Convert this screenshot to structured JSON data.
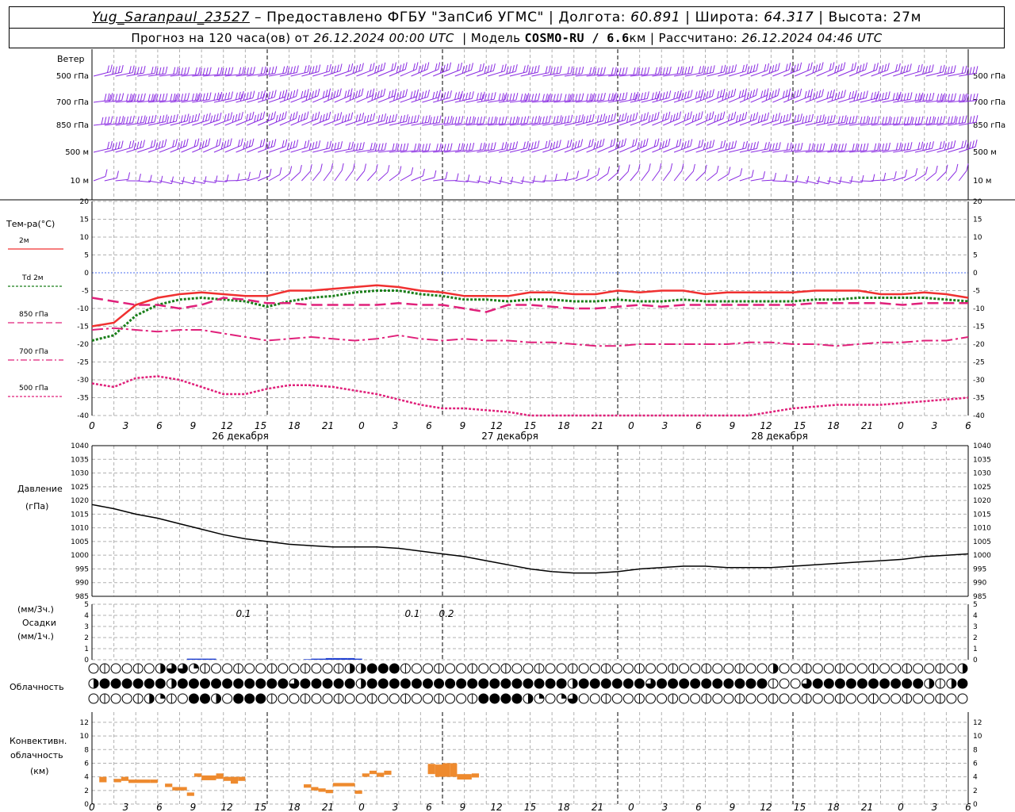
{
  "header": {
    "station": "Yug_Saranpaul_23527",
    "provider": "– Предоставлено ФГБУ \"ЗапСиб УГМС\"",
    "lon_label": "Долгота:",
    "lon": "60.891",
    "lat_label": "Широта:",
    "lat": "64.317",
    "alt_label": "Высота:",
    "alt": "27м",
    "forecast_prefix": "Прогноз на 120 часа(ов) от",
    "forecast_start": "26.12.2024 00:00 UTC",
    "model_label": "Модель",
    "model": "COSMO-RU / 6.6",
    "model_unit": "км",
    "calc_label": "Рассчитано:",
    "calc_time": "26.12.2024 04:46 UTC"
  },
  "wind_panel": {
    "title": "Ветер",
    "levels": [
      "500 гПа",
      "700 гПа",
      "850 гПа",
      "500 м",
      "10 м"
    ],
    "color": "#8a2be2"
  },
  "temp_panel": {
    "title": "Тем-ра(°C)",
    "legend": [
      {
        "label": "2м",
        "color": "#f03030",
        "style": "solid"
      },
      {
        "label": "Td 2м",
        "color": "#1a7f1a",
        "style": "dotted"
      },
      {
        "label": "850 гПа",
        "color": "#e0207a",
        "style": "dashed"
      },
      {
        "label": "700 гПа",
        "color": "#e0207a",
        "style": "dashdot"
      },
      {
        "label": "500 гПа",
        "color": "#e0207a",
        "style": "dotted"
      }
    ],
    "yticks": [
      "20",
      "15",
      "10",
      "5",
      "0",
      "-5",
      "-10",
      "-15",
      "-20",
      "-25",
      "-30",
      "-35",
      "-40"
    ]
  },
  "xaxis": {
    "hour_labels": [
      "0",
      "3",
      "6",
      "9",
      "12",
      "15",
      "18",
      "21",
      "0",
      "3",
      "6",
      "9",
      "12",
      "15",
      "18",
      "21",
      "0",
      "3",
      "6",
      "9",
      "12",
      "15",
      "18",
      "21",
      "0",
      "3",
      "6"
    ],
    "day_labels": [
      "26 декабря",
      "27 декабря",
      "28 декабря"
    ]
  },
  "pressure_panel": {
    "title": "Давление",
    "unit": "(гПа)",
    "yticks": [
      "1040",
      "1035",
      "1030",
      "1025",
      "1020",
      "1015",
      "1010",
      "1005",
      "1000",
      "995",
      "990",
      "985"
    ]
  },
  "precip_panel": {
    "unit_top": "(мм/3ч.)",
    "title": "Осадки",
    "unit_bottom": "(мм/1ч.)",
    "yticks": [
      "5",
      "4",
      "3",
      "2",
      "1",
      "0"
    ],
    "annotations": [
      "0.1",
      "0.1",
      "0.2"
    ]
  },
  "cloud_panel": {
    "title": "Облачность"
  },
  "conv_panel": {
    "title_line1": "Конвективн.",
    "title_line2": "облачность",
    "unit": "(км)",
    "yticks": [
      "12",
      "10",
      "8",
      "6",
      "4",
      "2",
      "0"
    ]
  },
  "chart_data": [
    {
      "type": "line",
      "title": "Тем-ра(°C)",
      "x_hours": [
        0,
        3,
        6,
        9,
        12,
        15,
        18,
        21,
        24,
        27,
        30,
        33,
        36,
        39,
        42,
        45,
        48,
        51,
        54,
        57,
        60,
        63,
        66,
        69,
        72,
        75,
        78,
        81,
        84,
        87,
        90,
        93,
        96,
        99,
        102,
        105,
        108,
        111,
        114,
        117,
        120
      ],
      "ylim": [
        -40,
        20
      ],
      "series": [
        {
          "name": "2м",
          "values": [
            -15,
            -14,
            -9,
            -7,
            -6,
            -5.5,
            -6,
            -6.5,
            -6.5,
            -5,
            -5,
            -4.5,
            -4,
            -3.5,
            -4,
            -5,
            -5.5,
            -6.5,
            -6.5,
            -6.5,
            -5.5,
            -5.5,
            -6,
            -6,
            -5,
            -5.5,
            -5,
            -5,
            -6,
            -5.5,
            -5.5,
            -5.5,
            -5.5,
            -5,
            -5,
            -5,
            -6,
            -6,
            -5.5,
            -6,
            -7
          ]
        },
        {
          "name": "Td 2м",
          "values": [
            -19,
            -17.5,
            -12,
            -9,
            -7.5,
            -7,
            -7.5,
            -8,
            -9.5,
            -8,
            -7,
            -6.5,
            -5.5,
            -5,
            -5,
            -6,
            -6.5,
            -7.5,
            -7.5,
            -8,
            -7.5,
            -7.5,
            -8,
            -8,
            -7.5,
            -8,
            -8,
            -7.5,
            -8,
            -8,
            -8,
            -8,
            -8,
            -7.5,
            -7.5,
            -7,
            -7,
            -7,
            -7,
            -7.5,
            -8
          ]
        },
        {
          "name": "850 гПа",
          "values": [
            -7,
            -8,
            -9,
            -9,
            -10,
            -9,
            -7,
            -7.5,
            -8.5,
            -8.5,
            -9,
            -9,
            -9,
            -9,
            -8.5,
            -9,
            -9,
            -10,
            -11,
            -9,
            -9,
            -9.5,
            -10,
            -10,
            -9.5,
            -9,
            -9.5,
            -9,
            -9,
            -9,
            -9,
            -9,
            -9,
            -8.5,
            -8.5,
            -8.5,
            -8.5,
            -9,
            -8.5,
            -8.5,
            -8.5
          ]
        },
        {
          "name": "700 гПа",
          "values": [
            -16,
            -15.5,
            -16,
            -16.5,
            -16,
            -16,
            -17,
            -18,
            -19,
            -18.5,
            -18,
            -18.5,
            -19,
            -18.5,
            -17.5,
            -18.5,
            -19,
            -18.5,
            -19,
            -19,
            -19.5,
            -19.5,
            -20,
            -20.5,
            -20.5,
            -20,
            -20,
            -20,
            -20,
            -20,
            -19.5,
            -19.5,
            -20,
            -20,
            -20.5,
            -20,
            -19.5,
            -19.5,
            -19,
            -19,
            -18
          ]
        },
        {
          "name": "500 гПа",
          "values": [
            -31,
            -32,
            -29.5,
            -29,
            -30,
            -32,
            -34,
            -34,
            -32.5,
            -31.5,
            -31.5,
            -32,
            -33,
            -34,
            -35.5,
            -37,
            -38,
            -38,
            -38.5,
            -39,
            -40,
            -41,
            -41.5,
            -42,
            -42.5,
            -43,
            -43,
            -43,
            -43,
            -42,
            -40,
            -39,
            -38,
            -37.5,
            -37,
            -37,
            -37,
            -36.5,
            -36,
            -35.5,
            -35
          ]
        }
      ]
    },
    {
      "type": "line",
      "title": "Давление (гПа)",
      "x_hours": [
        0,
        3,
        6,
        9,
        12,
        15,
        18,
        21,
        24,
        27,
        30,
        33,
        36,
        39,
        42,
        45,
        48,
        51,
        54,
        57,
        60,
        63,
        66,
        69,
        72,
        75,
        78,
        81,
        84,
        87,
        90,
        93,
        96,
        99,
        102,
        105,
        108,
        111,
        114,
        117,
        120
      ],
      "ylim": [
        985,
        1040
      ],
      "series": [
        {
          "name": "давление",
          "values": [
            1018.5,
            1017,
            1015,
            1013.5,
            1011.5,
            1009.5,
            1007.5,
            1006,
            1005,
            1004,
            1003.5,
            1003,
            1003,
            1003,
            1002.5,
            1001.5,
            1000.5,
            999.5,
            998,
            996.5,
            995,
            994,
            993.5,
            993.5,
            994,
            995,
            995.5,
            996,
            996,
            995.5,
            995.5,
            995.5,
            996,
            996.5,
            997,
            997.5,
            998,
            998.5,
            999.5,
            1000,
            1000.5
          ]
        }
      ]
    },
    {
      "type": "bar",
      "title": "Осадки (мм/1ч.)",
      "x_hours": [
        13,
        14,
        15,
        16,
        29,
        30,
        31,
        32,
        33,
        34,
        35,
        36
      ],
      "values": [
        0.1,
        0.1,
        0.1,
        0.1,
        0.05,
        0.1,
        0.1,
        0.15,
        0.15,
        0.15,
        0.15,
        0.1
      ],
      "ylim": [
        0,
        5
      ]
    },
    {
      "type": "bar",
      "title": "Конвективн. облачность (км)",
      "ylim": [
        0,
        13
      ],
      "segments": [
        {
          "x_hours": [
            1,
            2
          ],
          "base": 3.2,
          "top": 4.0
        },
        {
          "x_hours": [
            3,
            4
          ],
          "base": 3.2,
          "top": 3.7
        },
        {
          "x_hours": [
            4,
            5
          ],
          "base": 3.4,
          "top": 4.0
        },
        {
          "x_hours": [
            5,
            8
          ],
          "base": 3.1,
          "top": 3.6
        },
        {
          "x_hours": [
            8,
            9
          ],
          "base": 3.1,
          "top": 3.6
        },
        {
          "x_hours": [
            10,
            11
          ],
          "base": 2.5,
          "top": 3.0
        },
        {
          "x_hours": [
            11,
            12
          ],
          "base": 2.0,
          "top": 2.5
        },
        {
          "x_hours": [
            12,
            13
          ],
          "base": 2.0,
          "top": 2.5
        },
        {
          "x_hours": [
            13,
            14
          ],
          "base": 1.2,
          "top": 1.7
        },
        {
          "x_hours": [
            14,
            15
          ],
          "base": 4.0,
          "top": 4.5
        },
        {
          "x_hours": [
            15,
            17
          ],
          "base": 3.5,
          "top": 4.2
        },
        {
          "x_hours": [
            17,
            18
          ],
          "base": 3.7,
          "top": 4.5
        },
        {
          "x_hours": [
            18,
            19
          ],
          "base": 3.4,
          "top": 4.0
        },
        {
          "x_hours": [
            19,
            20
          ],
          "base": 3.0,
          "top": 4.0
        },
        {
          "x_hours": [
            20,
            21
          ],
          "base": 3.4,
          "top": 4.0
        },
        {
          "x_hours": [
            29,
            30
          ],
          "base": 2.4,
          "top": 2.9
        },
        {
          "x_hours": [
            30,
            31
          ],
          "base": 2.0,
          "top": 2.5
        },
        {
          "x_hours": [
            31,
            32
          ],
          "base": 1.8,
          "top": 2.3
        },
        {
          "x_hours": [
            32,
            33
          ],
          "base": 1.6,
          "top": 2.1
        },
        {
          "x_hours": [
            33,
            36
          ],
          "base": 2.6,
          "top": 3.1
        },
        {
          "x_hours": [
            36,
            37
          ],
          "base": 1.5,
          "top": 2.0
        },
        {
          "x_hours": [
            37,
            38
          ],
          "base": 4.0,
          "top": 4.5
        },
        {
          "x_hours": [
            38,
            39
          ],
          "base": 4.4,
          "top": 4.9
        },
        {
          "x_hours": [
            39,
            40
          ],
          "base": 4.0,
          "top": 4.6
        },
        {
          "x_hours": [
            40,
            41
          ],
          "base": 4.3,
          "top": 4.9
        },
        {
          "x_hours": [
            46,
            47
          ],
          "base": 4.4,
          "top": 5.9
        },
        {
          "x_hours": [
            47,
            48
          ],
          "base": 4.0,
          "top": 5.8
        },
        {
          "x_hours": [
            48,
            49
          ],
          "base": 4.0,
          "top": 6.0
        },
        {
          "x_hours": [
            49,
            50
          ],
          "base": 4.0,
          "top": 6.0
        },
        {
          "x_hours": [
            50,
            52
          ],
          "base": 3.6,
          "top": 4.4
        },
        {
          "x_hours": [
            52,
            53
          ],
          "base": 3.9,
          "top": 4.5
        }
      ]
    }
  ],
  "cloud_rows": [
    "ooooooHT3QoooooooooooooHHXXXoooooooooooooooooooooooooooooooooHooooooooooooooooHooooooooooo",
    "HXXXXXXHXXXXXXXXXX3XXXXXHXXXXXXXXXXXXXXXXXXHXXXXXX3XXXXXXXXXXoooTXXXXXXXXXXHoHXXH3oooooooooooooooo",
    "oooooHQooXXHoXXXoooooooooooooooooooXXXXHQoQTooooooooooooooooooooooooooooooooooooooooooo"
  ]
}
